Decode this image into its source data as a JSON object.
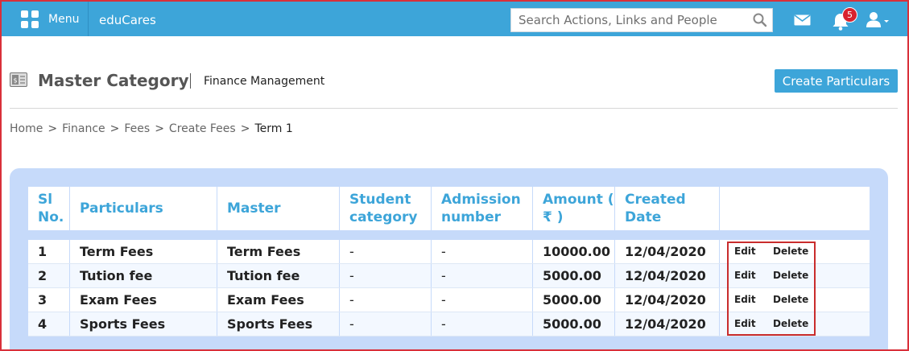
{
  "topbar": {
    "menu_label": "Menu",
    "brand": "eduCares",
    "search_placeholder": "Search Actions, Links and People",
    "notification_count": "5"
  },
  "page": {
    "title": "Master Category",
    "subtitle": "Finance Management",
    "create_button": "Create Particulars"
  },
  "breadcrumb": [
    "Home",
    "Finance",
    "Fees",
    "Create Fees",
    "Term 1"
  ],
  "table": {
    "headers": [
      "Sl No.",
      "Particulars",
      "Master",
      "Student category",
      "Admission number",
      "Amount ( ₹ )",
      "Created Date"
    ],
    "rows": [
      {
        "sl": "1",
        "particulars": "Term Fees",
        "master": "Term Fees",
        "student_category": "-",
        "admission_number": "-",
        "amount": "10000.00",
        "date": "12/04/2020"
      },
      {
        "sl": "2",
        "particulars": "Tution fee",
        "master": "Tution fee",
        "student_category": "-",
        "admission_number": "-",
        "amount": "5000.00",
        "date": "12/04/2020"
      },
      {
        "sl": "3",
        "particulars": "Exam Fees",
        "master": "Exam Fees",
        "student_category": "-",
        "admission_number": "-",
        "amount": "5000.00",
        "date": "12/04/2020"
      },
      {
        "sl": "4",
        "particulars": "Sports Fees",
        "master": "Sports Fees",
        "student_category": "-",
        "admission_number": "-",
        "amount": "5000.00",
        "date": "12/04/2020"
      }
    ],
    "edit_label": "Edit",
    "delete_label": "Delete"
  },
  "colors": {
    "accent": "#3da5d9",
    "panel": "#c6dafa",
    "highlight_border": "#c92c2c",
    "badge": "#d9232e"
  },
  "icons": [
    "menu-grid-icon",
    "search-icon",
    "mail-icon",
    "bell-icon",
    "user-icon",
    "finance-icon"
  ]
}
